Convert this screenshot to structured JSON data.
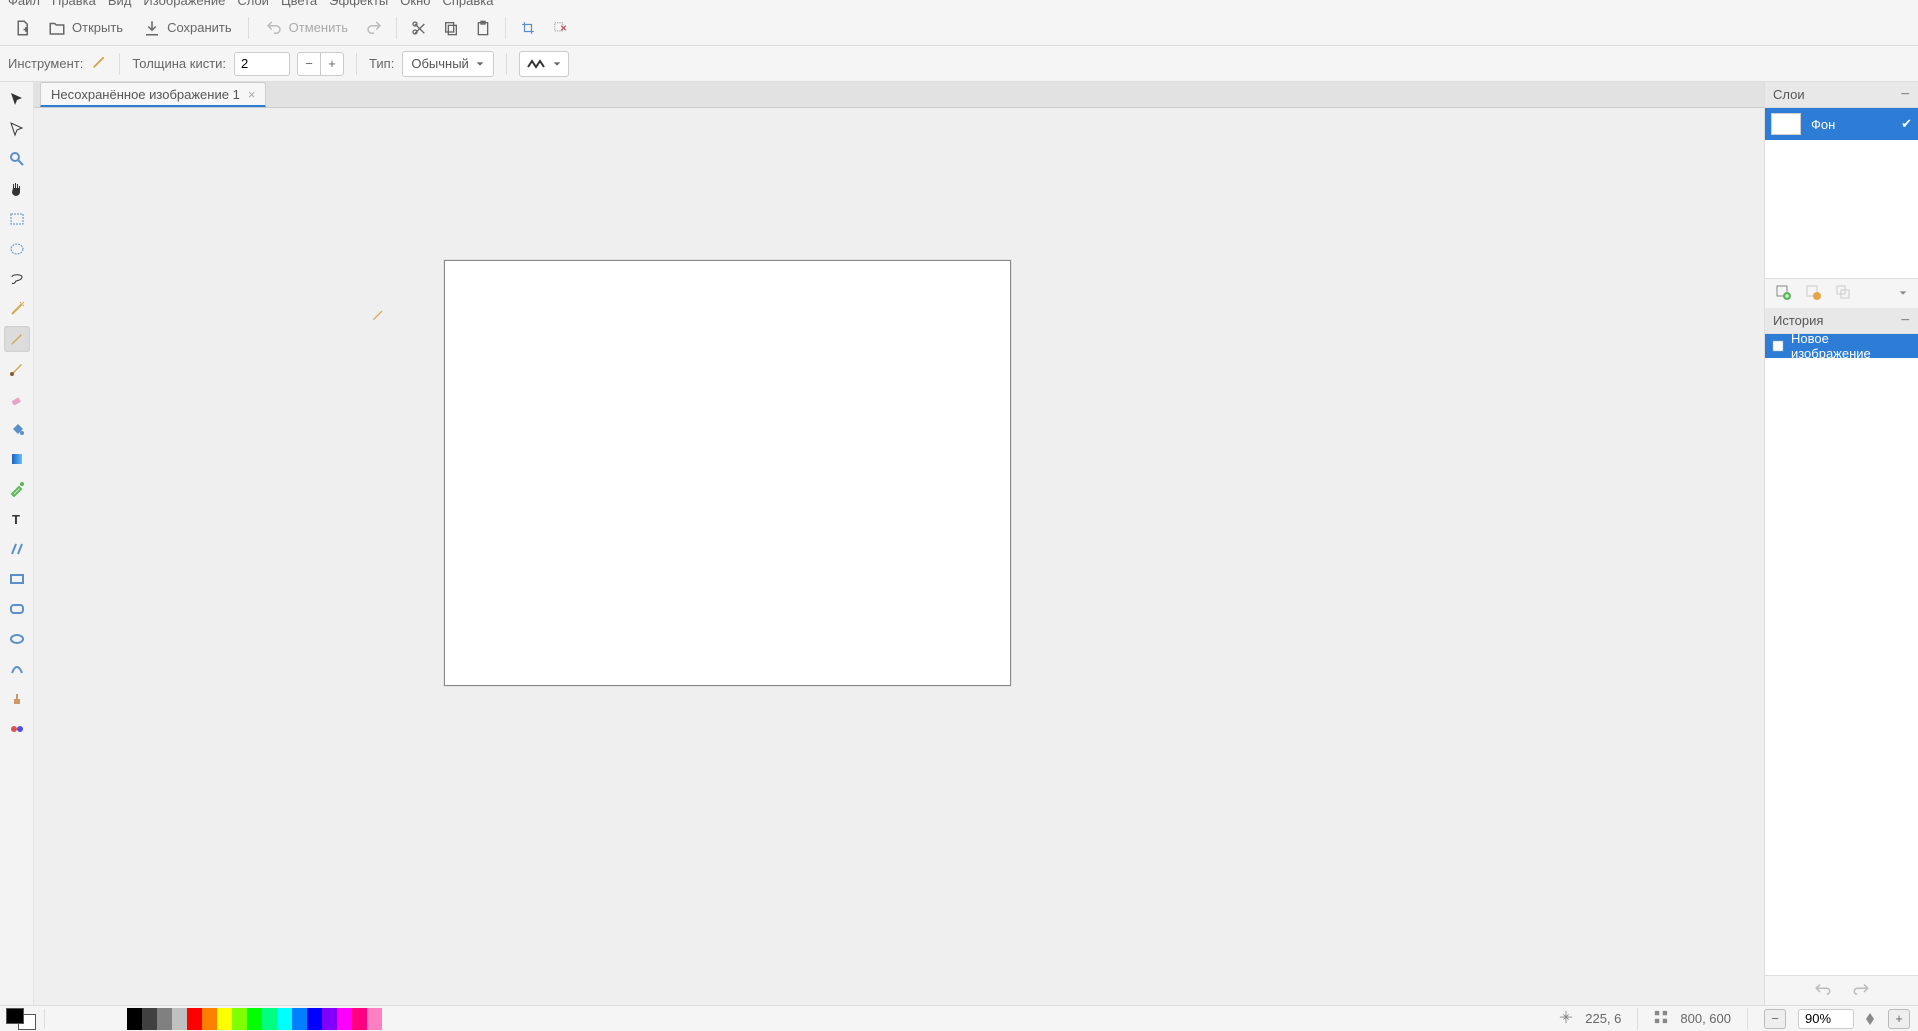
{
  "menu": {
    "file": "Файл",
    "edit": "Правка",
    "view": "Вид",
    "image": "Изображение",
    "layers": "Слои",
    "colors": "Цвета",
    "effects": "Эффекты",
    "window": "Окно",
    "help": "Справка"
  },
  "toolbar": {
    "open": "Открыть",
    "save": "Сохранить",
    "undo": "Отменить"
  },
  "options": {
    "tool_label": "Инструмент:",
    "brush_label": "Толщина кисти:",
    "brush_value": "2",
    "type_label": "Тип:",
    "type_value": "Обычный"
  },
  "tab": {
    "title": "Несохранённое изображение 1"
  },
  "panels": {
    "layers_title": "Слои",
    "history_title": "История",
    "layer_name": "Фон",
    "history_item": "Новое изображение"
  },
  "status": {
    "cursor_pos": "225, 6",
    "canvas_size": "800, 600",
    "zoom": "90%"
  },
  "palette": [
    "#000000",
    "#404040",
    "#808080",
    "#c0c0c0",
    "#ff0000",
    "#ff8000",
    "#ffff00",
    "#80ff00",
    "#00ff00",
    "#00ff80",
    "#00ffff",
    "#0080ff",
    "#0000ff",
    "#8000ff",
    "#ff00ff",
    "#ff0080",
    "#ff80c0"
  ]
}
